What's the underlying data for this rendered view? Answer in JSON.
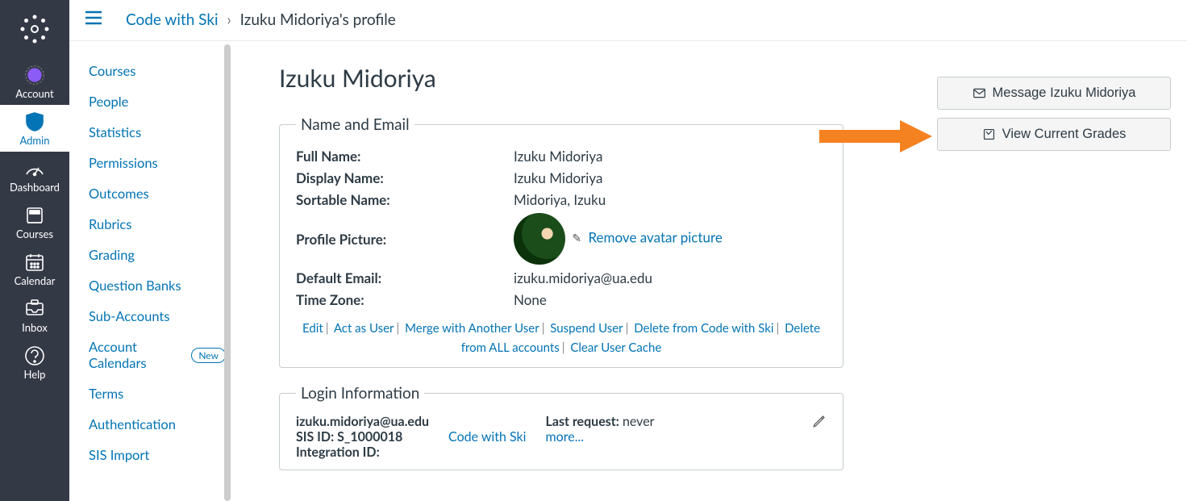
{
  "global_nav": {
    "logo": "canvas-logo",
    "items": [
      {
        "label": "Account",
        "icon": "account"
      },
      {
        "label": "Admin",
        "icon": "shield",
        "active": true
      },
      {
        "label": "Dashboard",
        "icon": "gauge"
      },
      {
        "label": "Courses",
        "icon": "book"
      },
      {
        "label": "Calendar",
        "icon": "calendar"
      },
      {
        "label": "Inbox",
        "icon": "inbox"
      },
      {
        "label": "Help",
        "icon": "help"
      }
    ]
  },
  "breadcrumb": {
    "root": "Code with Ski",
    "current": "Izuku Midoriya's profile"
  },
  "context_nav": [
    {
      "label": "Courses"
    },
    {
      "label": "People"
    },
    {
      "label": "Statistics"
    },
    {
      "label": "Permissions"
    },
    {
      "label": "Outcomes"
    },
    {
      "label": "Rubrics"
    },
    {
      "label": "Grading"
    },
    {
      "label": "Question Banks"
    },
    {
      "label": "Sub-Accounts"
    },
    {
      "label": "Account Calendars",
      "badge": "New"
    },
    {
      "label": "Terms"
    },
    {
      "label": "Authentication"
    },
    {
      "label": "SIS Import"
    }
  ],
  "page": {
    "title": "Izuku Midoriya",
    "sections": {
      "name_email": {
        "legend": "Name and Email",
        "full_name_label": "Full Name:",
        "full_name": "Izuku Midoriya",
        "display_name_label": "Display Name:",
        "display_name": "Izuku Midoriya",
        "sortable_name_label": "Sortable Name:",
        "sortable_name": "Midoriya, Izuku",
        "profile_picture_label": "Profile Picture:",
        "remove_avatar": "Remove avatar picture",
        "default_email_label": "Default Email:",
        "default_email": "izuku.midoriya@ua.edu",
        "time_zone_label": "Time Zone:",
        "time_zone": "None",
        "actions": {
          "edit": "Edit",
          "act_as": "Act as User",
          "merge": "Merge with Another User",
          "suspend": "Suspend User",
          "delete_account": "Delete from Code with Ski",
          "delete_all": "Delete from ALL accounts",
          "clear_cache": "Clear User Cache"
        }
      },
      "login": {
        "legend": "Login Information",
        "login_id": "izuku.midoriya@ua.edu",
        "sis_id_label": "SIS ID:",
        "sis_id": "S_1000018",
        "integration_id_label": "Integration ID:",
        "integration_id": "",
        "account_link": "Code with Ski",
        "last_request_label": "Last request:",
        "last_request": "never",
        "more": "more..."
      }
    }
  },
  "side_actions": {
    "message": "Message Izuku Midoriya",
    "grades": "View Current Grades"
  }
}
